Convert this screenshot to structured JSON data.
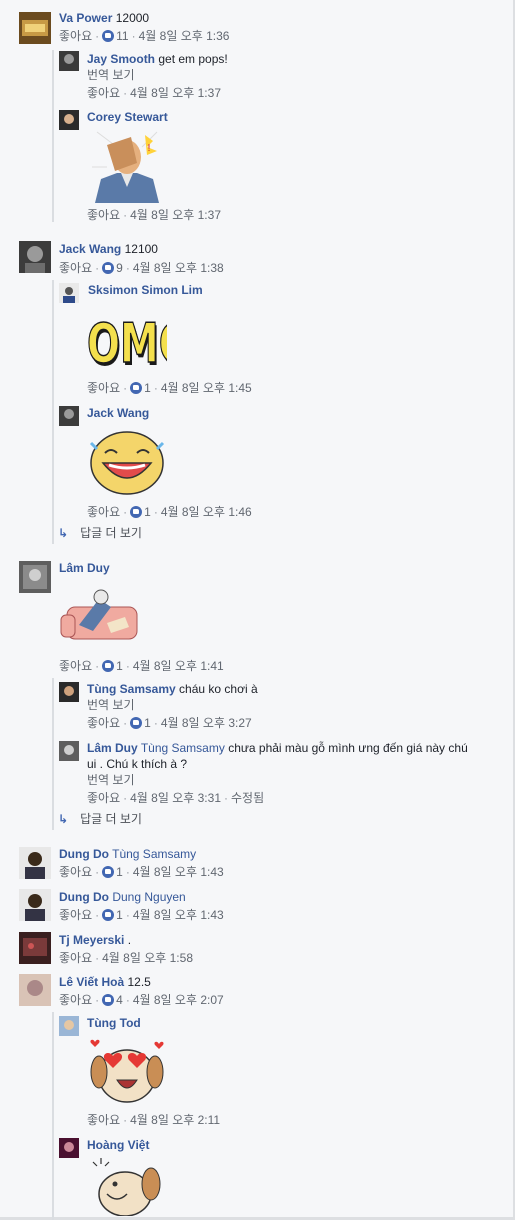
{
  "common": {
    "like": "좋아요",
    "translate": "번역 보기",
    "more_replies": "답글 더 보기",
    "edited": "수정됨"
  },
  "comments": [
    {
      "author": "Va Power",
      "text": "12000",
      "likes": "11",
      "time": "4월 8일 오후 1:36"
    },
    {
      "author": "Jay Smooth",
      "text": "get em pops!",
      "time": "4월 8일 오후 1:37"
    },
    {
      "author": "Corey Stewart",
      "time": "4월 8일 오후 1:37"
    },
    {
      "author": "Jack Wang",
      "text": "12100",
      "likes": "9",
      "time": "4월 8일 오후 1:38"
    },
    {
      "author": "Sksimon Simon Lim",
      "likes": "1",
      "time": "4월 8일 오후 1:45",
      "sticker_text": "OMG"
    },
    {
      "author": "Jack Wang",
      "likes": "1",
      "time": "4월 8일 오후 1:46"
    },
    {
      "author": "Lâm Duy",
      "likes": "1",
      "time": "4월 8일 오후 1:41"
    },
    {
      "author": "Tùng Samsamy",
      "text": "cháu ko chơi à",
      "likes": "1",
      "time": "4월 8일 오후 3:27"
    },
    {
      "author": "Lâm Duy",
      "tag": "Tùng Samsamy",
      "text": "chưa phải màu gỗ mình ưng đến giá này chú ui . Chú k thích à ?",
      "time": "4월 8일 오후 3:31"
    },
    {
      "author": "Dung Do",
      "tag": "Tùng Samsamy",
      "likes": "1",
      "time": "4월 8일 오후 1:43"
    },
    {
      "author": "Dung Do",
      "tag": "Dung Nguyen",
      "likes": "1",
      "time": "4월 8일 오후 1:43"
    },
    {
      "author": "Tj Meyerski",
      "text": ".",
      "time": "4월 8일 오후 1:58"
    },
    {
      "author": "Lê Viết Hoà",
      "text": "12.5",
      "likes": "4",
      "time": "4월 8일 오후 2:07"
    },
    {
      "author": "Tùng Tod",
      "time": "4월 8일 오후 2:11"
    },
    {
      "author": "Hoàng Việt"
    }
  ]
}
